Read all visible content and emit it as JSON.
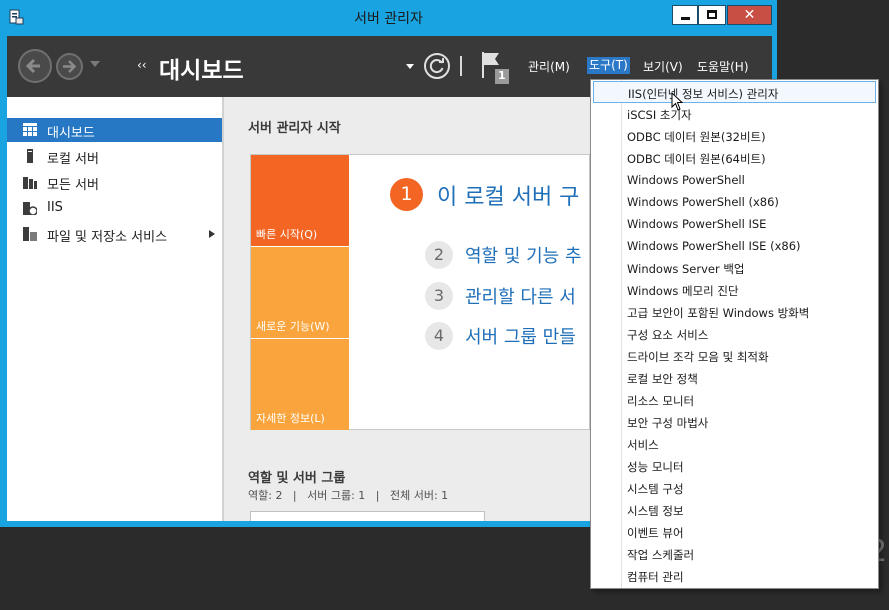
{
  "window": {
    "title": "서버 관리자",
    "close_glyph": "✕"
  },
  "toolbar": {
    "crumb_arrows": "‹‹",
    "page_title": "대시보드",
    "flag_count": "1",
    "menus": [
      "관리(M)",
      "도구(T)",
      "보기(V)",
      "도움말(H)"
    ]
  },
  "sidebar": {
    "items": [
      {
        "label": "대시보드",
        "icon": "dashboard-icon",
        "active": true
      },
      {
        "label": "로컬 서버",
        "icon": "local-server-icon",
        "active": false
      },
      {
        "label": "모든 서버",
        "icon": "all-servers-icon",
        "active": false
      },
      {
        "label": "IIS",
        "icon": "iis-icon",
        "active": false
      },
      {
        "label": "파일 및 저장소 서비스",
        "icon": "file-storage-icon",
        "active": false
      }
    ]
  },
  "content": {
    "section_title": "서버 관리자 시작",
    "tiles": [
      "빠른 시작(Q)",
      "새로운 기능(W)",
      "자세한 정보(L)"
    ],
    "steps": [
      {
        "num": "1",
        "text": "이 로컬 서버 구"
      },
      {
        "num": "2",
        "text": "역할 및 기능 추"
      },
      {
        "num": "3",
        "text": "관리할 다른 서"
      },
      {
        "num": "4",
        "text": "서버 그룹 만들"
      }
    ],
    "roles_title": "역할 및 서버 그룹",
    "roles_counts": "역할: 2   |   서버 그룹: 1   |   전체 서버: 1"
  },
  "tools_menu": {
    "items": [
      "IIS(인터넷 정보 서비스) 관리자",
      "iSCSI 초기자",
      "ODBC 데이터 원본(32비트)",
      "ODBC 데이터 원본(64비트)",
      "Windows PowerShell",
      "Windows PowerShell (x86)",
      "Windows PowerShell ISE",
      "Windows PowerShell ISE (x86)",
      "Windows Server 백업",
      "Windows 메모리 진단",
      "고급 보안이 포함된 Windows 방화벽",
      "구성 요소 서비스",
      "드라이브 조각 모음 및 최적화",
      "로컬 보안 정책",
      "리소스 모니터",
      "보안 구성 마법사",
      "서비스",
      "성능 모니터",
      "시스템 구성",
      "시스템 정보",
      "이벤트 뷰어",
      "작업 스케줄러",
      "컴퓨터 관리"
    ],
    "highlighted_index": 0
  },
  "desktop": {
    "corner_digit": "2"
  },
  "colors": {
    "titlebar": "#19a3e0",
    "toolbar": "#393939",
    "accent": "#2678c5",
    "tile_orange": "#f26522",
    "tile_amber": "#f9a43c",
    "link_blue": "#1f6fb9",
    "close_red": "#c74f44"
  }
}
